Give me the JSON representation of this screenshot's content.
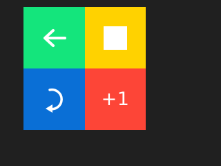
{
  "tiles": [
    {
      "id": "back",
      "icon": "arrow-left-icon",
      "color": "#14e57c"
    },
    {
      "id": "stop",
      "icon": "stop-square-icon",
      "color": "#ffd200"
    },
    {
      "id": "undo",
      "icon": "rotate-undo-icon",
      "color": "#0a6fd6"
    },
    {
      "id": "plus",
      "icon": "",
      "color": "#fd4537",
      "label": "+1"
    }
  ],
  "background": "#202020"
}
